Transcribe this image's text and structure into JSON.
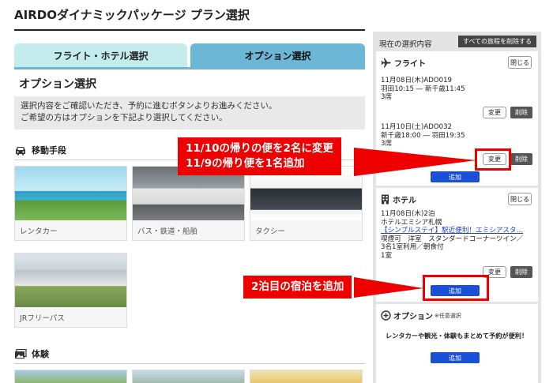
{
  "page": {
    "title": "AIRDOダイナミックパッケージ プラン選択"
  },
  "tabs": [
    {
      "label": "フライト・ホテル選択"
    },
    {
      "label": "オプション選択"
    }
  ],
  "main": {
    "section_title": "オプション選択",
    "notice_lines": [
      "選択内容をご確認いただき、予約に進むボタンよりお進みください。",
      "ご希望の方はオプションを下記より選択してください。"
    ],
    "categories": [
      {
        "title": "移動手段",
        "icon": "car-icon",
        "cards": [
          {
            "label": "レンタカー"
          },
          {
            "label": "バス・鉄道・船舶"
          },
          {
            "label": "タクシー"
          },
          {
            "label": "JRフリーパス"
          }
        ]
      },
      {
        "title": "体験",
        "icon": "photo-icon"
      }
    ]
  },
  "sidebar": {
    "heading": "現在の選択内容",
    "delete_all_label": "すべての旅程を削除する",
    "flight": {
      "title": "フライト",
      "close_label": "閉じる",
      "legs": [
        {
          "line1": "11月08日(木)ADO019",
          "line2": "羽田10:15 ― 新千歳11:45",
          "line3": "3席"
        },
        {
          "line1": "11月10日(土)ADO032",
          "line2": "新千歳18:00 ― 羽田19:35",
          "line3": "3席"
        }
      ],
      "change_label": "変更",
      "delete_label": "削除",
      "add_label": "追加"
    },
    "hotel": {
      "title": "ホテル",
      "close_label": "閉じる",
      "lines": [
        "11月08日(木)2泊",
        "ホテルエミシア札幌",
        "【シンプルステイ】駅近便利！エミシアスタ…",
        "喫煙可　洋室　スタンダードコーナーツイン／",
        "3名1室利用／朝食付",
        "1室"
      ],
      "change_label": "変更",
      "delete_label": "削除",
      "add_label": "追加"
    },
    "option": {
      "title": "オプション",
      "note": "※任意選択",
      "promo": "レンタカーや観光・体験もまとめて予約が便利！",
      "add_label": "追加"
    }
  },
  "annotations": {
    "flight_callout": [
      "11/10の帰りの便を2名に変更",
      "11/9の帰り便を1名追加"
    ],
    "hotel_callout": "2泊目の宿泊を追加",
    "highlight_color": "#ee0000"
  }
}
